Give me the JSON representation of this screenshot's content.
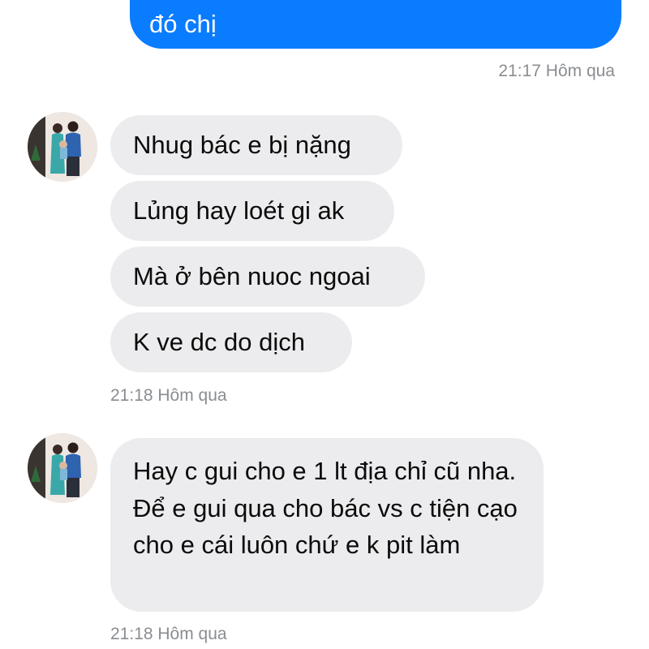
{
  "outgoing": {
    "text": "đó chị",
    "timestamp": "21:17 Hôm qua"
  },
  "incoming_group_1": {
    "avatar": "avatar-photo",
    "messages": [
      "Nhug bác e bị nặng",
      "Lủng hay loét gi ak",
      "Mà ở bên nuoc ngoai",
      "K ve dc do dịch"
    ],
    "timestamp": "21:18 Hôm qua"
  },
  "incoming_group_2": {
    "avatar": "avatar-photo",
    "message": "Hay c gui cho e 1 lt địa chỉ cũ nha. Để e gui qua cho bác vs c tiện cạo cho e cái luôn chứ e k pit làm",
    "timestamp": "21:18 Hôm qua"
  },
  "colors": {
    "outgoing_bubble": "#0a7cff",
    "incoming_bubble": "#ececee",
    "timestamp": "#8a8d91"
  }
}
